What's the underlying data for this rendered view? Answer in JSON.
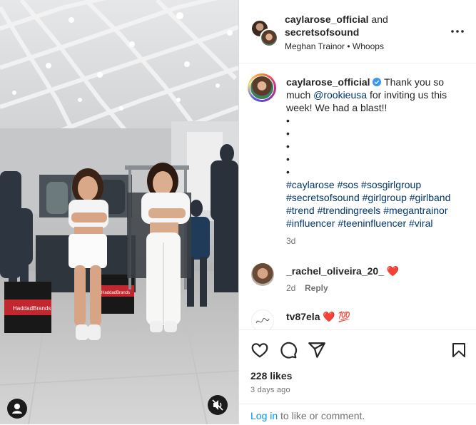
{
  "post": {
    "author1": "caylarose_official",
    "and_text": "and",
    "author2": "secretsofsound",
    "audio": "Meghan Trainor • Whoops",
    "more_icon": "more-horizontal-icon"
  },
  "caption": {
    "username": "caylarose_official",
    "text_part1": "Thank you so much",
    "mention": "@rookieusa",
    "text_part2": "for inviting us this week! We had a blast!!",
    "bullets": [
      "•",
      "•",
      "•",
      "•",
      "•"
    ],
    "hashtags_line1": "#caylarose #sos #sosgirlgroup",
    "hashtags_line2": "#secretsofsound #girlgroup #girlband",
    "hashtags_line3": "#trend #trendingreels #megantrainor",
    "hashtags_line4": "#influencer #teeninfluencer #viral",
    "time": "3d"
  },
  "comments": [
    {
      "username": "_rachel_oliveira_20_",
      "emoji": "❤️",
      "time": "2d",
      "reply": "Reply"
    },
    {
      "username": "tv87ela",
      "emoji": "❤️ 💯"
    }
  ],
  "media": {
    "bag_text": "HaddadBrands",
    "bag_text2": "HaddadBrands",
    "mute_icon": "speaker-muted-icon",
    "user_icon": "user-icon"
  },
  "actions": {
    "likes": "228 likes",
    "date": "3 days ago"
  },
  "footer": {
    "login": "Log in",
    "rest": "to like or comment."
  }
}
